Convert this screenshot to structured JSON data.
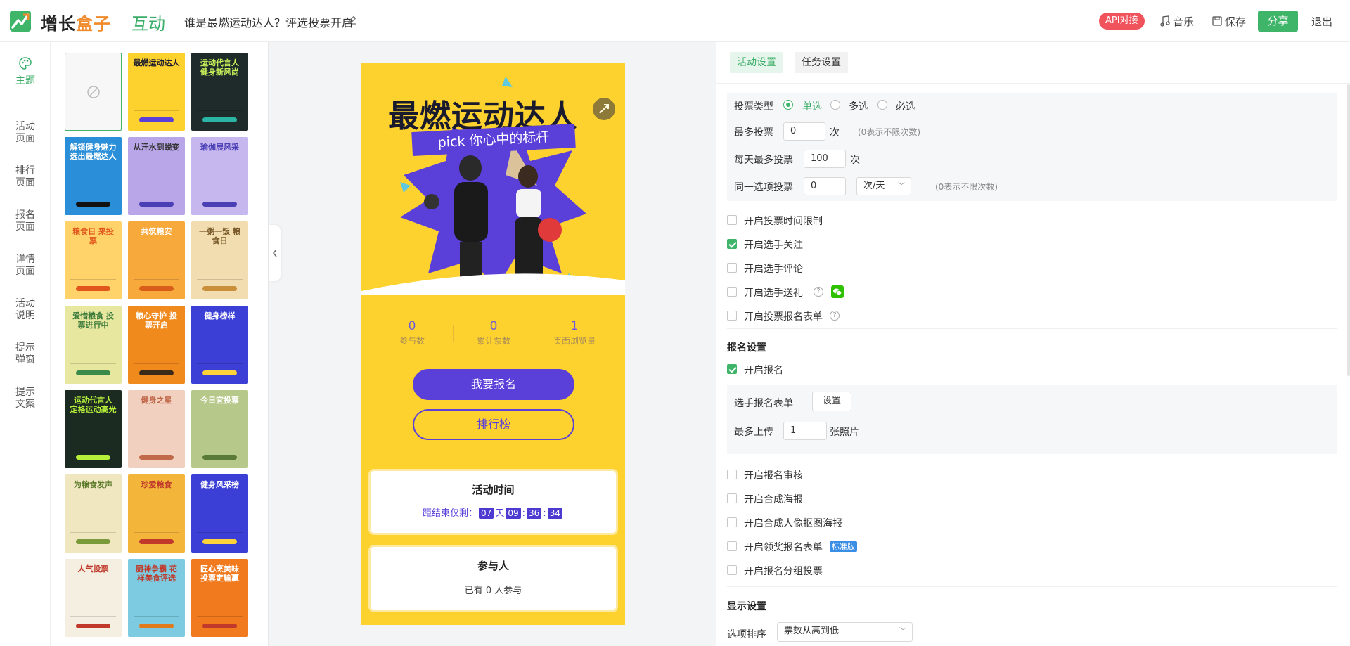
{
  "header": {
    "brand_part1": "增长",
    "brand_part2": "盒子",
    "module": "互动",
    "activity_title": "谁是最燃运动达人？评选投票开启",
    "api_badge": "API对接",
    "music": "音乐",
    "save": "保存",
    "share": "分享",
    "exit": "退出"
  },
  "leftnav": {
    "items": [
      "主题",
      "活动页面",
      "排行页面",
      "报名页面",
      "详情页面",
      "活动说明",
      "提示弹窗",
      "提示文案"
    ]
  },
  "templates": [
    {
      "title": "",
      "bg": "#f7f7f7",
      "fg": "#999",
      "btn": "#ffffff"
    },
    {
      "title": "最燃运动达人",
      "bg": "#fdd22e",
      "fg": "#1a1a2e",
      "btn": "#5b3fd9"
    },
    {
      "title": "运动代言人 健身新风尚",
      "bg": "#1f2a2a",
      "fg": "#c7f05a",
      "btn": "#2bb3a3"
    },
    {
      "title": "解锁健身魅力 选出最燃达人",
      "bg": "#2a8fd8",
      "fg": "#ffffff",
      "btn": "#111111"
    },
    {
      "title": "从汗水到蜕变",
      "bg": "#b9a6e8",
      "fg": "#333333",
      "btn": "#4a3fb5"
    },
    {
      "title": "瑜伽展风采",
      "bg": "#c7b7ef",
      "fg": "#4a3fb5",
      "btn": "#4a3fb5"
    },
    {
      "title": "粮食日 来投票",
      "bg": "#ffd36a",
      "fg": "#e0561c",
      "btn": "#e0561c"
    },
    {
      "title": "共筑粮安",
      "bg": "#f7a93c",
      "fg": "#ffffff",
      "btn": "#d85c1a"
    },
    {
      "title": "一粥一饭 粮食日",
      "bg": "#f2ddb0",
      "fg": "#7a5a2a",
      "btn": "#c98f3a"
    },
    {
      "title": "爱惜粮食 投票进行中",
      "bg": "#e8e7a0",
      "fg": "#3a7a3a",
      "btn": "#3a8a4a"
    },
    {
      "title": "粮心守护 投票开启",
      "bg": "#f08a1d",
      "fg": "#ffffff",
      "btn": "#3a2a1a"
    },
    {
      "title": "健身榜样",
      "bg": "#3b3fd6",
      "fg": "#ffffff",
      "btn": "#ffd23a"
    },
    {
      "title": "运动代言人 定格运动高光",
      "bg": "#1b2b22",
      "fg": "#b6ef3a",
      "btn": "#b6ef3a"
    },
    {
      "title": "健身之星",
      "bg": "#f2d0c0",
      "fg": "#c06a4a",
      "btn": "#c06a4a"
    },
    {
      "title": "今日宜投票",
      "bg": "#b7c98a",
      "fg": "#ffffff",
      "btn": "#5a7a3a"
    },
    {
      "title": "为粮食发声",
      "bg": "#f0e7c0",
      "fg": "#5a7a2a",
      "btn": "#7a9a3a"
    },
    {
      "title": "珍爱粮食",
      "bg": "#f3b53a",
      "fg": "#c0392b",
      "btn": "#c0392b"
    },
    {
      "title": "健身风采榜",
      "bg": "#3b3fd6",
      "fg": "#ffffff",
      "btn": "#ffd23a"
    },
    {
      "title": "人气投票",
      "bg": "#f5efe2",
      "fg": "#c0392b",
      "btn": "#c0392b"
    },
    {
      "title": "厨神争霸 花样美食评选",
      "bg": "#7ccbe0",
      "fg": "#c0392b",
      "btn": "#e07a1a"
    },
    {
      "title": "匠心烹美味 投票定输赢",
      "bg": "#f07a1d",
      "fg": "#ffffff",
      "btn": "#c0392b"
    }
  ],
  "preview": {
    "hero_title": "最燃运动达人",
    "pick_text": "pick 你心中的标杆",
    "stats": [
      {
        "num": "0",
        "label": "参与数"
      },
      {
        "num": "0",
        "label": "累计票数"
      },
      {
        "num": "1",
        "label": "页面浏览量"
      }
    ],
    "signup_btn": "我要报名",
    "rank_btn": "排行榜",
    "time_card_title": "活动时间",
    "countdown_prefix": "距结束仅剩：",
    "countdown_days": "07",
    "countdown_day_unit": "天",
    "countdown_h": "09",
    "countdown_m": "36",
    "countdown_s": "34",
    "participants_title": "参与人",
    "participants_text": "已有 0 人参与"
  },
  "settings": {
    "tab_active": "活动设置",
    "tab_other": "任务设置",
    "vote_type_label": "投票类型",
    "vote_options": [
      "单选",
      "多选",
      "必选"
    ],
    "max_vote_label": "最多投票",
    "max_vote_value": "0",
    "max_vote_unit": "次",
    "max_vote_hint": "(0表示不限次数)",
    "daily_max_label": "每天最多投票",
    "daily_max_value": "100",
    "daily_max_unit": "次",
    "same_option_label": "同一选项投票",
    "same_option_value": "0",
    "same_option_select": "次/天",
    "same_option_hint": "(0表示不限次数)",
    "checks": [
      {
        "label": "开启投票时间限制",
        "checked": false
      },
      {
        "label": "开启选手关注",
        "checked": true
      },
      {
        "label": "开启选手评论",
        "checked": false
      },
      {
        "label": "开启选手送礼",
        "checked": false
      },
      {
        "label": "开启投票报名表单",
        "checked": false
      }
    ],
    "signup_section": "报名设置",
    "signup_enable": "开启报名",
    "form_label": "选手报名表单",
    "form_btn": "设置",
    "upload_label": "最多上传",
    "upload_value": "1",
    "upload_unit": "张照片",
    "signup_checks": [
      {
        "label": "开启报名审核",
        "checked": false
      },
      {
        "label": "开启合成海报",
        "checked": false
      },
      {
        "label": "开启合成人像抠图海报",
        "checked": false
      },
      {
        "label": "开启领奖报名表单",
        "checked": false
      },
      {
        "label": "开启报名分组投票",
        "checked": false
      }
    ],
    "std_badge": "标准版",
    "display_section": "显示设置",
    "sort_label": "选项排序",
    "sort_value": "票数从高到低"
  },
  "colors": {
    "accent": "#3fb56a",
    "purple": "#5b3fd9",
    "yellow": "#fdd22e",
    "api_red": "#f0535c"
  }
}
